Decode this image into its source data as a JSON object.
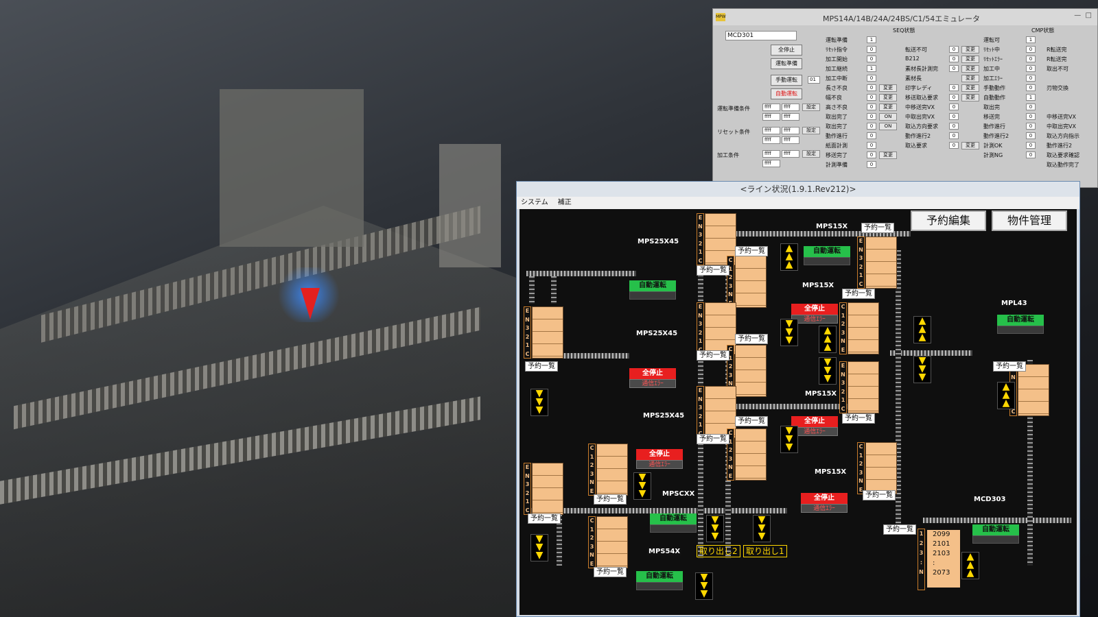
{
  "colors": {
    "auto": "#26c04a",
    "stop": "#e81f1f",
    "box": "#f4c089",
    "arrow": "#ffd700",
    "marker": "#e32020"
  },
  "emulator": {
    "title": "MPS14A/14B/24A/24BS/C1/54エミュレータ",
    "logo": "MPW",
    "device": "MCD301",
    "buttons": {
      "all_stop": "全停止",
      "prep": "運転準備",
      "manual": "手動運転",
      "auto": "自動運転",
      "manual_no": "01"
    },
    "conds": [
      {
        "label": "運転準備条件",
        "v1": "ffff",
        "v2": "ffff",
        "v3": "ffff",
        "v4": "ffff",
        "btn": "設定"
      },
      {
        "label": "リセット条件",
        "v1": "ffff",
        "v2": "ffff",
        "v3": "ffff",
        "v4": "ffff",
        "btn": "設定"
      },
      {
        "label": "加工条件",
        "v1": "ffff",
        "v2": "ffff",
        "v3": "ffff",
        "btn": "設定"
      }
    ],
    "seq_title": "SEQ状態",
    "cmp_title": "CMP状態",
    "seq_left": [
      {
        "l": "運転準備",
        "v": "1"
      },
      {
        "l": "ﾘｾｯﾄ指令",
        "v": "0"
      },
      {
        "l": "加工開始",
        "v": "0"
      },
      {
        "l": "加工継続",
        "v": "1"
      },
      {
        "l": "加工中断",
        "v": "0"
      },
      {
        "l": "長さ不良",
        "v": "0",
        "b": "変更"
      },
      {
        "l": "幅不良",
        "v": "0",
        "b": "変更"
      },
      {
        "l": "高さ不良",
        "v": "0",
        "b": "変更"
      },
      {
        "l": "取出完了",
        "v": "0",
        "b": "ON"
      },
      {
        "l": "取出完了",
        "v": "0",
        "b": "ON"
      },
      {
        "l": "動作進行",
        "v": "0"
      },
      {
        "l": "紙面計測",
        "v": "0"
      },
      {
        "l": "移送完了",
        "v": "0",
        "b": "変更"
      },
      {
        "l": "計測準備",
        "v": "0"
      }
    ],
    "seq_right": [
      {
        "l": "転送不可",
        "v": "0",
        "b": "変更"
      },
      {
        "l": "B212",
        "v": "0",
        "b": "変更"
      },
      {
        "l": "素材長計測完",
        "v": "0",
        "b": "変更"
      },
      {
        "l": "素材長",
        "v": "",
        "b": "変更"
      },
      {
        "l": "印字レディ",
        "v": "0",
        "b": "変更"
      },
      {
        "l": "移送取込要求",
        "v": "0",
        "b": "変更"
      },
      {
        "l": "中移送完VX",
        "v": "0"
      },
      {
        "l": "中取出完VX",
        "v": "0"
      },
      {
        "l": "取込方向要求",
        "v": "0"
      },
      {
        "l": "動作進行2",
        "v": "0"
      },
      {
        "l": "取込要求",
        "v": "0",
        "b": "変更"
      }
    ],
    "cmp_left": [
      {
        "l": "運転可",
        "v": "1"
      },
      {
        "l": "ﾘｾｯﾄ中",
        "v": "0"
      },
      {
        "l": "ﾘｾｯﾄｴﾗｰ",
        "v": "0"
      },
      {
        "l": "加工中",
        "v": "0"
      },
      {
        "l": "加工ｴﾗｰ",
        "v": "0"
      },
      {
        "l": "手動動作",
        "v": "0"
      },
      {
        "l": "自動動作",
        "v": "1"
      },
      {
        "l": "取出完",
        "v": "0"
      },
      {
        "l": "移送完",
        "v": "0"
      },
      {
        "l": "動作進行",
        "v": "0"
      },
      {
        "l": "動作進行2",
        "v": "0"
      },
      {
        "l": "計測OK",
        "v": "0"
      },
      {
        "l": "計測NG",
        "v": "0"
      }
    ],
    "cmp_right": [
      "R転送完",
      "R転送完",
      "取出不可",
      "",
      "刃物交換",
      "",
      "",
      "中移送完VX",
      "中取出完VX",
      "取込方向指示",
      "動作進行2",
      "取込要求確認",
      "取込動作完了"
    ]
  },
  "line": {
    "title": "<ライン状況(1.9.1.Rev212)>",
    "menu": [
      "システム",
      "補正"
    ],
    "btn_reserve": "予約編集",
    "btn_items": "物件管理",
    "list": "予約一覧",
    "col_top": [
      "E",
      "N",
      "3",
      "2",
      "1",
      "C"
    ],
    "col_bot": [
      "C",
      "1",
      "2",
      "3",
      "N",
      "E"
    ],
    "auto": "自動運転",
    "stop": "全停止",
    "comm_err": "通信ｴﾗｰ",
    "machines": [
      "MPS25X45",
      "MPS25X45",
      "MPS25X45",
      "MPS15X",
      "MPS15X",
      "MPS15X",
      "MPS15X",
      "MPSCXX",
      "MPS54X",
      "MPL43",
      "MCD303"
    ],
    "take1": "取り出し1",
    "take2": "取り出し2",
    "counter": [
      "2099",
      "2101",
      "2103",
      ":",
      "2073"
    ],
    "counter_idx": [
      "1",
      "2",
      "3",
      ":",
      "N"
    ]
  }
}
